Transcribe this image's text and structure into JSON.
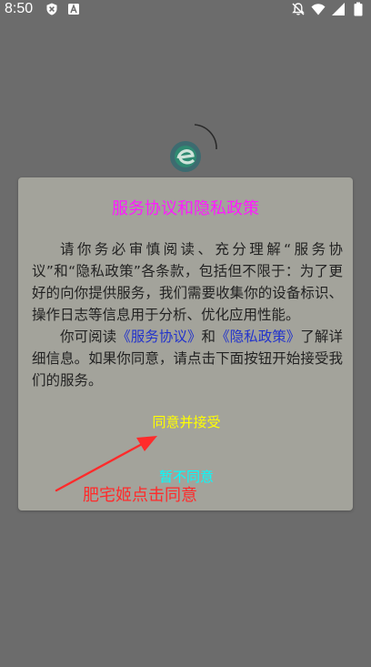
{
  "status_bar": {
    "time": "8:50",
    "left_icons": [
      "shield-icon",
      "app-a-icon"
    ],
    "right_icons": [
      "notifications-off-icon",
      "wifi-icon",
      "signal-icon",
      "battery-icon"
    ]
  },
  "colors": {
    "background": "#6c6c6c",
    "dialog": "#a3a39b",
    "title": "#ff1aff",
    "link": "#2233cc",
    "accept": "#ffff00",
    "decline": "#00ffff",
    "annotation": "#ff2b2b"
  },
  "dialog": {
    "title": "服务协议和隐私政策",
    "paragraph1": "请你务必审慎阅读、充分理解“服务协议”和“隐私政策”各条款，包括但不限于：为了更好的向你提供服务，我们需要收集你的设备标识、操作日志等信息用于分析、优化应用性能。",
    "paragraph2_prefix": "你可阅读",
    "service_link": "《服务协议》",
    "paragraph2_and": "和",
    "privacy_link": "《隐私政策》",
    "paragraph2_suffix": "了解详细信息。如果你同意，请点击下面按钮开始接受我们的服务。",
    "accept_label": "同意并接受",
    "decline_label": "暂不同意"
  },
  "annotation": {
    "text": "肥宅姬点击同意"
  }
}
